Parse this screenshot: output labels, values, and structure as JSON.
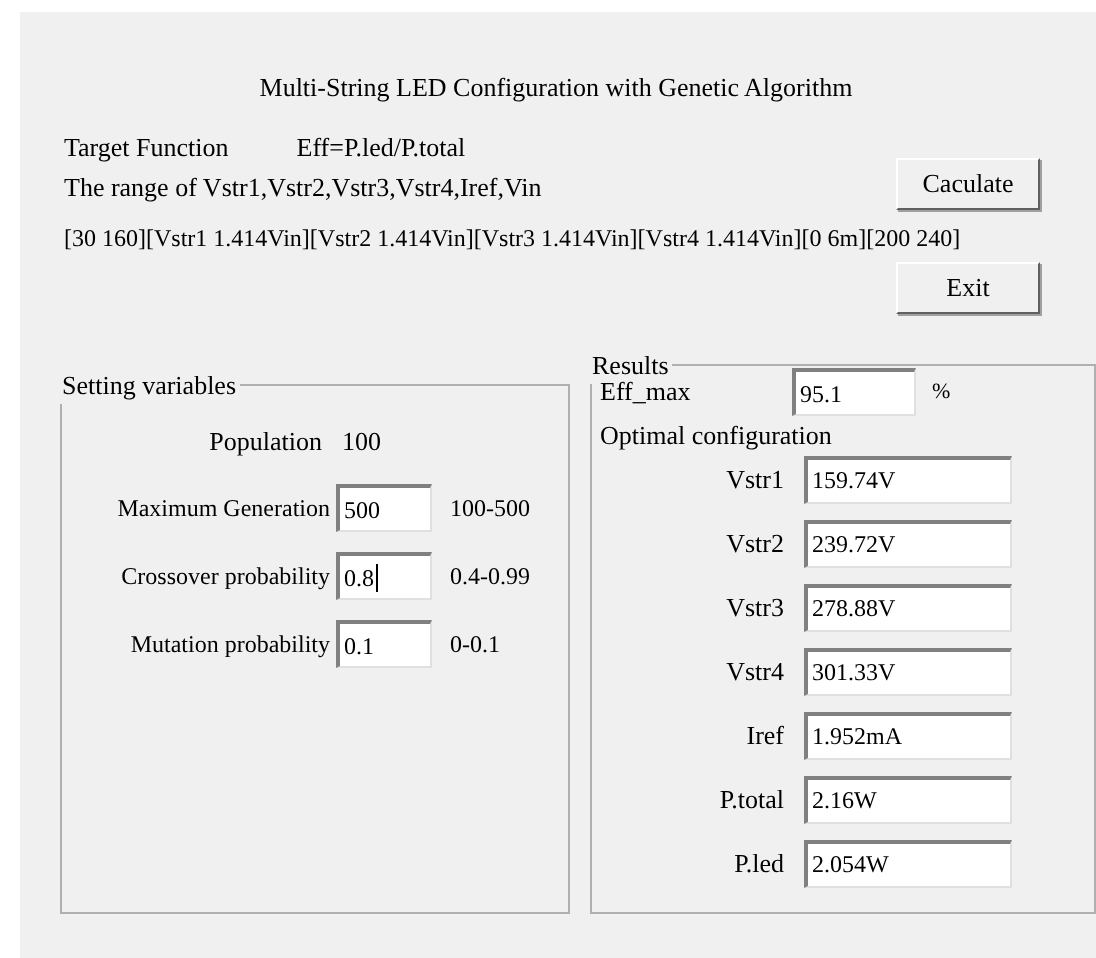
{
  "title": "Multi-String LED Configuration with Genetic Algorithm",
  "target_function": {
    "label": "Target Function",
    "formula": "Eff=P.led/P.total"
  },
  "range": {
    "label": "The range of Vstr1,Vstr2,Vstr3,Vstr4,Iref,Vin",
    "values": "[30 160][Vstr1 1.414Vin][Vstr2 1.414Vin][Vstr3 1.414Vin][Vstr4 1.414Vin][0 6m][200 240]"
  },
  "buttons": [
    {
      "label": "Caculate"
    },
    {
      "label": "Exit"
    }
  ],
  "settings": {
    "title": "Setting variables",
    "population": {
      "label": "Population",
      "value": "100"
    },
    "fields": [
      {
        "label": "Maximum Generation",
        "value": "500",
        "range": "100-500",
        "focused": false
      },
      {
        "label": "Crossover probability",
        "value": "0.8",
        "range": "0.4-0.99",
        "focused": true
      },
      {
        "label": "Mutation probability",
        "value": "0.1",
        "range": "0-0.1",
        "focused": false
      }
    ]
  },
  "results": {
    "title": "Results",
    "eff_max": {
      "label": "Eff_max",
      "value": "95.1",
      "unit": "%"
    },
    "optimal_label": "Optimal configuration",
    "fields": [
      {
        "label": "Vstr1",
        "value": "159.74V"
      },
      {
        "label": "Vstr2",
        "value": "239.72V"
      },
      {
        "label": "Vstr3",
        "value": "278.88V"
      },
      {
        "label": "Vstr4",
        "value": "301.33V"
      },
      {
        "label": "Iref",
        "value": "1.952mA"
      },
      {
        "label": "P.total",
        "value": "2.16W"
      },
      {
        "label": "P.led",
        "value": "2.054W"
      }
    ]
  }
}
